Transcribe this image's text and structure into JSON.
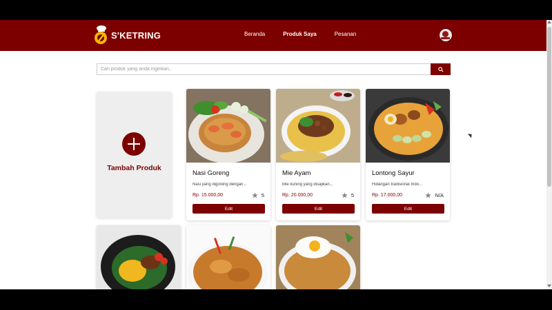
{
  "app": {
    "brand": "S'KETRING",
    "brand_color": "#7d0000"
  },
  "nav": {
    "items": [
      {
        "label": "Beranda",
        "active": false
      },
      {
        "label": "Produk Saya",
        "active": true
      },
      {
        "label": "Pesanan",
        "active": false
      }
    ],
    "avatar_icon": "user-avatar"
  },
  "search": {
    "placeholder": "Cari produk yang anda inginkan..",
    "value": "",
    "button_icon": "search-icon"
  },
  "add_product": {
    "label": "Tambah Produk",
    "icon": "plus-icon"
  },
  "products": [
    {
      "name": "Nasi Goreng",
      "description": "Nasi yang digoreng dengan...",
      "price": "Rp. 15.000,00",
      "rating": "5",
      "edit_label": "Edit"
    },
    {
      "name": "Mie Ayam",
      "description": "Mie kuning yang disajikan...",
      "price": "Rp. 20.000,00",
      "rating": "5",
      "edit_label": "Edit"
    },
    {
      "name": "Lontong Sayur",
      "description": "Hidangan tradisional Indo...",
      "price": "Rp. 17.000,00",
      "rating": "N/A",
      "edit_label": "Edit"
    }
  ],
  "more_products_visible": 3
}
